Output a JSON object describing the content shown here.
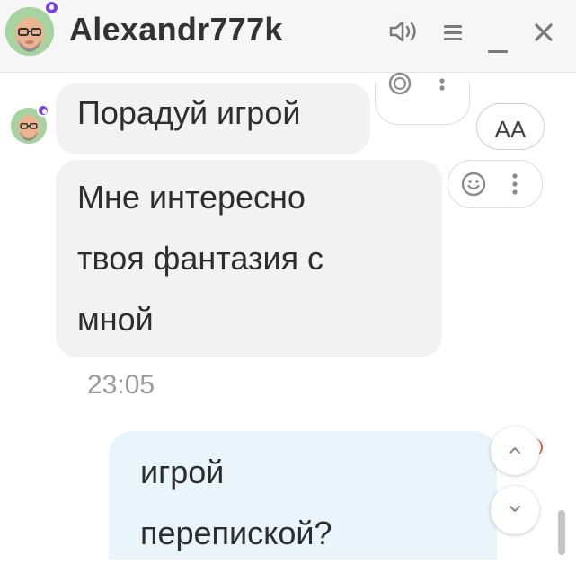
{
  "header": {
    "title": "Alexandr777k",
    "avatar_icon": "bald-man-avatar-icon",
    "badge_icon": "drop-badge-icon",
    "sound_icon": "speaker-icon",
    "menu_icon": "menu-icon",
    "minimize_icon": "minimize-icon",
    "close_icon": "close-icon"
  },
  "messages": [
    {
      "direction": "incoming",
      "text": "Порадуй игрой"
    },
    {
      "direction": "incoming",
      "text": "Мне интересно твоя фантазия с мной",
      "lines": [
        "Мне интересно",
        "твоя фантазия с",
        "мной"
      ],
      "time": "23:05"
    },
    {
      "direction": "outgoing",
      "lines": [
        "игрой",
        "перепиской?"
      ]
    }
  ],
  "font_size_button": {
    "label": "AA"
  },
  "colors": {
    "header_bg": "#f6f6f6",
    "incoming_bubble": "#f2f2f2",
    "outgoing_bubble": "#e9f5fb",
    "badge": "#7b3fe4",
    "timestamp": "#9a9a9a"
  }
}
